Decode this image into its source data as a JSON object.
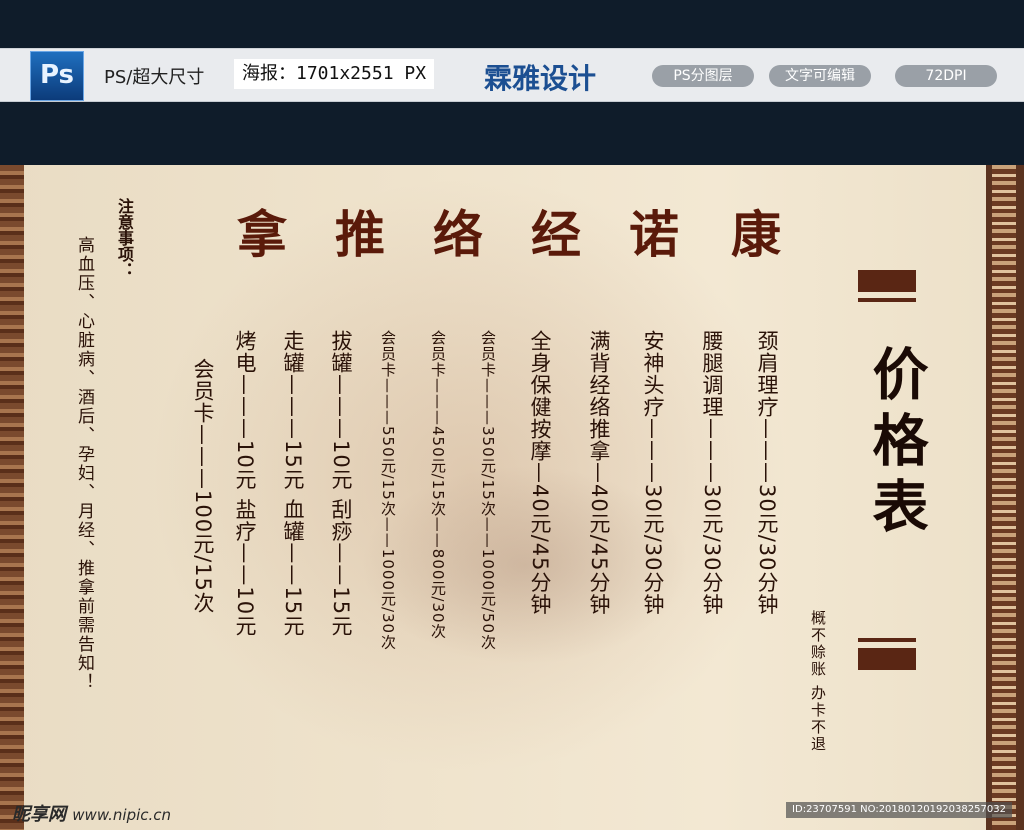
{
  "topbar": {
    "ps_logo": "Ps",
    "label1": "PS/超大尺寸",
    "label2": "海报：1701x2551 PX",
    "brand": "霖雅设计",
    "pills": [
      "PS分图层",
      "文字可编辑",
      "72DPI"
    ]
  },
  "poster": {
    "title": "价格表",
    "slogan": "概不赊账  办卡不退",
    "brand_name": [
      "康",
      "诺",
      "经",
      "络",
      "推",
      "拿"
    ],
    "items": [
      "颈肩理疗———30元/30分钟",
      "腰腿调理———30元/30分钟",
      "安神头疗———30元/30分钟",
      "满背经络推拿—40元/45分钟",
      "全身保健按摩—40元/45分钟",
      "会员卡———350元/15次——1000元/50次",
      "会员卡———450元/15次——800元/30次",
      "会员卡———550元/15次——1000元/30次",
      "拔罐———10元   刮痧——15元",
      "走罐———15元   血罐——15元",
      "烤电———10元   盐疗——10元",
      "会员卡———100元/15次"
    ],
    "notes_heading": "注意事项：",
    "notes": "高血压、心脏病、酒后、孕妇、月经、推拿前需告知！"
  },
  "watermark": {
    "logo": "昵享网",
    "url": "www.nipic.cn",
    "id": "ID:23707591 NO:20180120192038257032"
  }
}
